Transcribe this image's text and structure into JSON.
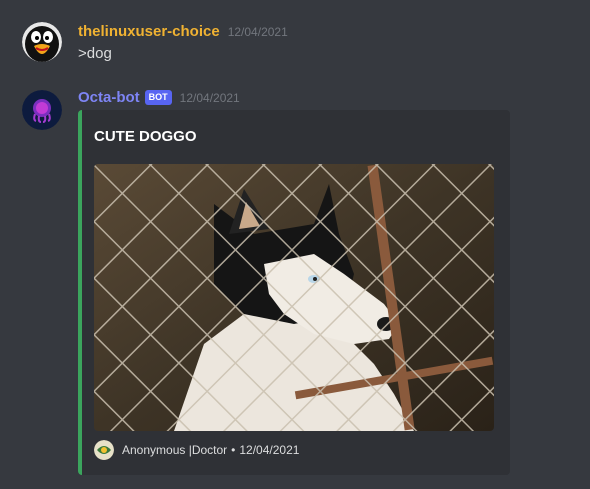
{
  "messages": [
    {
      "username": "thelinuxuser-choice",
      "username_color": "#f0b232",
      "timestamp": "12/04/2021",
      "content": ">dog",
      "avatar_icon": "penguin-icon"
    },
    {
      "username": "Octa-bot",
      "username_color": "#7e85f5",
      "bot_tag": "BOT",
      "timestamp": "12/04/2021",
      "avatar_icon": "octopus-icon",
      "embed": {
        "accent_color": "#3ba55d",
        "title": "CUTE DOGGO",
        "image_icon": "husky-dog-image",
        "footer": {
          "icon": "footer-avatar-icon",
          "text": "Anonymous |Doctor",
          "separator": "•",
          "date": "12/04/2021"
        }
      }
    }
  ]
}
